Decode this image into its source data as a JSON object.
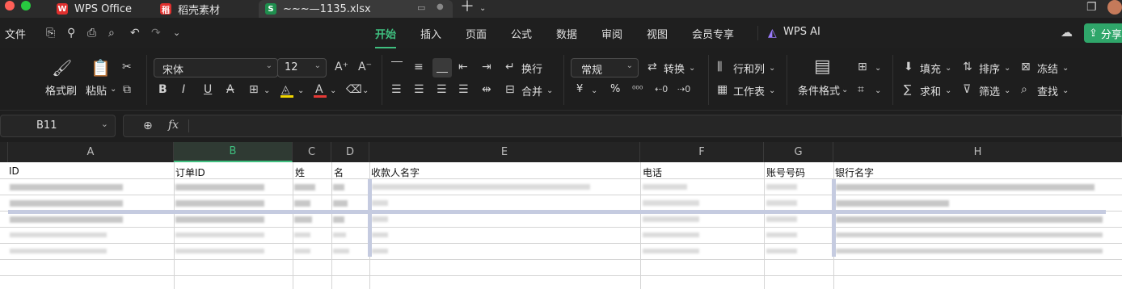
{
  "titlebar": {
    "tabs": [
      {
        "label": "WPS Office"
      },
      {
        "label": "稻壳素材"
      },
      {
        "label": "~~~—1135.xlsx"
      }
    ]
  },
  "menu": {
    "file": "文件",
    "items": [
      "开始",
      "插入",
      "页面",
      "公式",
      "数据",
      "审阅",
      "视图",
      "会员专享"
    ],
    "ai": "WPS AI",
    "share": "分享"
  },
  "ribbon": {
    "format_painter": "格式刷",
    "paste": "粘贴",
    "font_name": "宋体",
    "font_size": "12",
    "wrap": "换行",
    "merge": "合并",
    "number_format": "常规",
    "convert": "转换",
    "rows_cols": "行和列",
    "worksheet": "工作表",
    "cond_format": "条件格式",
    "fill": "填充",
    "sort": "排序",
    "freeze": "冻结",
    "sum": "求和",
    "filter": "筛选",
    "find": "查找",
    "currency": "¥",
    "percent": "%"
  },
  "formula": {
    "cell_ref": "B11",
    "fx": "fx"
  },
  "sheet": {
    "columns": [
      "A",
      "B",
      "C",
      "D",
      "E",
      "F",
      "G",
      "H"
    ],
    "header_row": [
      "ID",
      "订单ID",
      "姓",
      "名",
      "收款人名字",
      "电话",
      "账号号码",
      "银行名字"
    ]
  },
  "colors": {
    "accent": "#3fbf7f",
    "wps_red": "#e0302e",
    "sheet_green": "#1f8f4e"
  }
}
